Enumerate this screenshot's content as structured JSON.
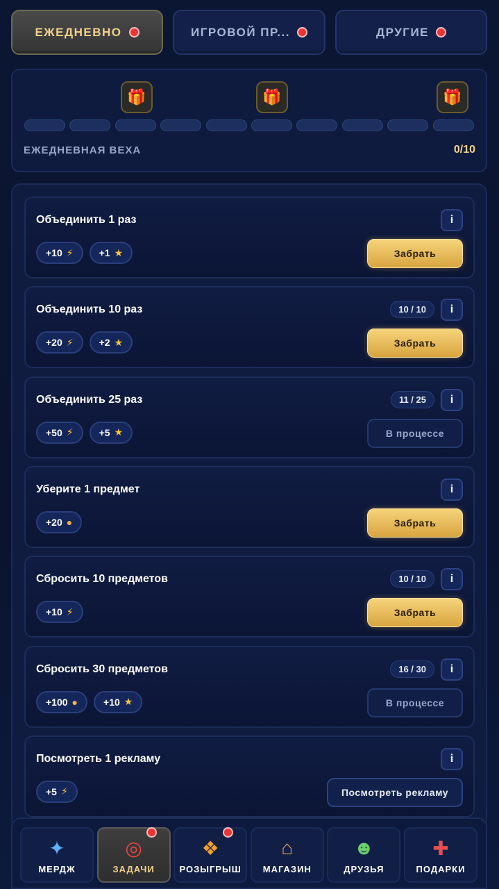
{
  "tabs": [
    {
      "label": "ЕЖЕДНЕВНО",
      "active": true,
      "dot": true
    },
    {
      "label": "ИГРОВОЙ ПР...",
      "active": false,
      "dot": true
    },
    {
      "label": "ДРУГИЕ",
      "active": false,
      "dot": true
    }
  ],
  "milestone": {
    "label": "ЕЖЕДНЕВНАЯ ВЕХА",
    "count": "0/10",
    "progress_fraction": 0,
    "segments": 10,
    "gift_icon": "gift-icon"
  },
  "tasks": [
    {
      "title": "Объединить 1 раз",
      "progress": "",
      "rewards": [
        {
          "value": "+10",
          "icon": "bolt"
        },
        {
          "value": "+1",
          "icon": "star"
        }
      ],
      "button": "Забрать",
      "button_type": "claim"
    },
    {
      "title": "Объединить 10 раз",
      "progress": "10 / 10",
      "rewards": [
        {
          "value": "+20",
          "icon": "bolt"
        },
        {
          "value": "+2",
          "icon": "star"
        }
      ],
      "button": "Забрать",
      "button_type": "claim"
    },
    {
      "title": "Объединить 25 раз",
      "progress": "11 / 25",
      "rewards": [
        {
          "value": "+50",
          "icon": "bolt"
        },
        {
          "value": "+5",
          "icon": "star"
        }
      ],
      "button": "В процессе",
      "button_type": "wait"
    },
    {
      "title": "Уберите 1 предмет",
      "progress": "",
      "rewards": [
        {
          "value": "+20",
          "icon": "coin"
        }
      ],
      "button": "Забрать",
      "button_type": "claim"
    },
    {
      "title": "Сбросить 10 предметов",
      "progress": "10 / 10",
      "rewards": [
        {
          "value": "+10",
          "icon": "bolt"
        }
      ],
      "button": "Забрать",
      "button_type": "claim"
    },
    {
      "title": "Сбросить 30 предметов",
      "progress": "16 / 30",
      "rewards": [
        {
          "value": "+100",
          "icon": "coin"
        },
        {
          "value": "+10",
          "icon": "star"
        }
      ],
      "button": "В процессе",
      "button_type": "wait"
    },
    {
      "title": "Посмотреть 1 рекламу",
      "progress": "",
      "rewards": [
        {
          "value": "+5",
          "icon": "bolt"
        }
      ],
      "button": "Посмотреть рекламу",
      "button_type": "ad"
    }
  ],
  "info_label": "i",
  "icons": {
    "bolt": "⚡",
    "star": "★",
    "coin": "●"
  },
  "nav": [
    {
      "label": "МЕРДЖ",
      "icon": "puzzle-icon",
      "glyph": "✦",
      "active": false,
      "dot": false
    },
    {
      "label": "ЗАДАЧИ",
      "icon": "target-icon",
      "glyph": "◎",
      "active": true,
      "dot": true
    },
    {
      "label": "РОЗЫГРЫШ",
      "icon": "prize-chest-icon",
      "glyph": "❖",
      "active": false,
      "dot": true
    },
    {
      "label": "МАГАЗИН",
      "icon": "shop-icon",
      "glyph": "⌂",
      "active": false,
      "dot": false
    },
    {
      "label": "ДРУЗЬЯ",
      "icon": "friends-icon",
      "glyph": "☻",
      "active": false,
      "dot": false
    },
    {
      "label": "ПОДАРКИ",
      "icon": "gift-icon",
      "glyph": "✚",
      "active": false,
      "dot": false
    }
  ],
  "colors": {
    "accent_gold": "#f2d28a",
    "claim_button": "#e6b95a",
    "background": "#0b1633",
    "red_dot": "#e33333"
  }
}
